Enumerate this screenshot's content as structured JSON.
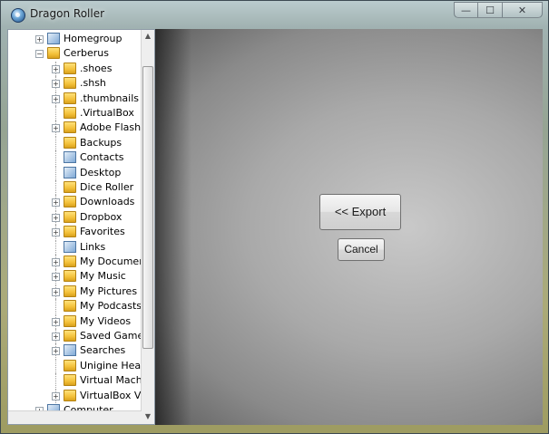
{
  "window": {
    "title": "Dragon Roller",
    "caption_buttons": {
      "minimize": "—",
      "maximize": "☐",
      "close": "✕"
    }
  },
  "tree": {
    "items": [
      {
        "label": "Homegroup",
        "level": 0,
        "expander": "+",
        "icon": "homegroup-icon"
      },
      {
        "label": "Cerberus",
        "level": 0,
        "expander": "−",
        "icon": "user-folder-icon"
      },
      {
        "label": ".shoes",
        "level": 1,
        "expander": "+",
        "icon": "folder-icon"
      },
      {
        "label": ".shsh",
        "level": 1,
        "expander": "+",
        "icon": "folder-icon"
      },
      {
        "label": ".thumbnails",
        "level": 1,
        "expander": "+",
        "icon": "folder-icon"
      },
      {
        "label": ".VirtualBox",
        "level": 1,
        "expander": "",
        "icon": "folder-icon"
      },
      {
        "label": "Adobe Flash B",
        "level": 1,
        "expander": "+",
        "icon": "folder-icon"
      },
      {
        "label": "Backups",
        "level": 1,
        "expander": "",
        "icon": "folder-icon"
      },
      {
        "label": "Contacts",
        "level": 1,
        "expander": "",
        "icon": "contacts-icon"
      },
      {
        "label": "Desktop",
        "level": 1,
        "expander": "",
        "icon": "desktop-icon"
      },
      {
        "label": "Dice Roller",
        "level": 1,
        "expander": "",
        "icon": "folder-icon"
      },
      {
        "label": "Downloads",
        "level": 1,
        "expander": "+",
        "icon": "downloads-icon"
      },
      {
        "label": "Dropbox",
        "level": 1,
        "expander": "+",
        "icon": "dropbox-icon"
      },
      {
        "label": "Favorites",
        "level": 1,
        "expander": "+",
        "icon": "favorites-icon"
      },
      {
        "label": "Links",
        "level": 1,
        "expander": "",
        "icon": "links-icon"
      },
      {
        "label": "My Documen",
        "level": 1,
        "expander": "+",
        "icon": "documents-icon"
      },
      {
        "label": "My Music",
        "level": 1,
        "expander": "+",
        "icon": "music-icon"
      },
      {
        "label": "My Pictures",
        "level": 1,
        "expander": "+",
        "icon": "pictures-icon"
      },
      {
        "label": "My Podcasts",
        "level": 1,
        "expander": "",
        "icon": "podcasts-icon"
      },
      {
        "label": "My Videos",
        "level": 1,
        "expander": "+",
        "icon": "videos-icon"
      },
      {
        "label": "Saved Games",
        "level": 1,
        "expander": "+",
        "icon": "saved-games-icon"
      },
      {
        "label": "Searches",
        "level": 1,
        "expander": "+",
        "icon": "searches-icon"
      },
      {
        "label": "Unigine Heav",
        "level": 1,
        "expander": "",
        "icon": "folder-icon"
      },
      {
        "label": "Virtual Machi",
        "level": 1,
        "expander": "",
        "icon": "folder-icon"
      },
      {
        "label": "VirtualBox VM",
        "level": 1,
        "expander": "+",
        "icon": "folder-icon"
      },
      {
        "label": "Computer",
        "level": 0,
        "expander": "+",
        "icon": "computer-icon"
      }
    ]
  },
  "actions": {
    "export_label": "<< Export",
    "cancel_label": "Cancel"
  },
  "colors": {
    "panel_background": "#a9a9a9",
    "folder": "#f3c13a",
    "tree_background": "#ffffff"
  }
}
